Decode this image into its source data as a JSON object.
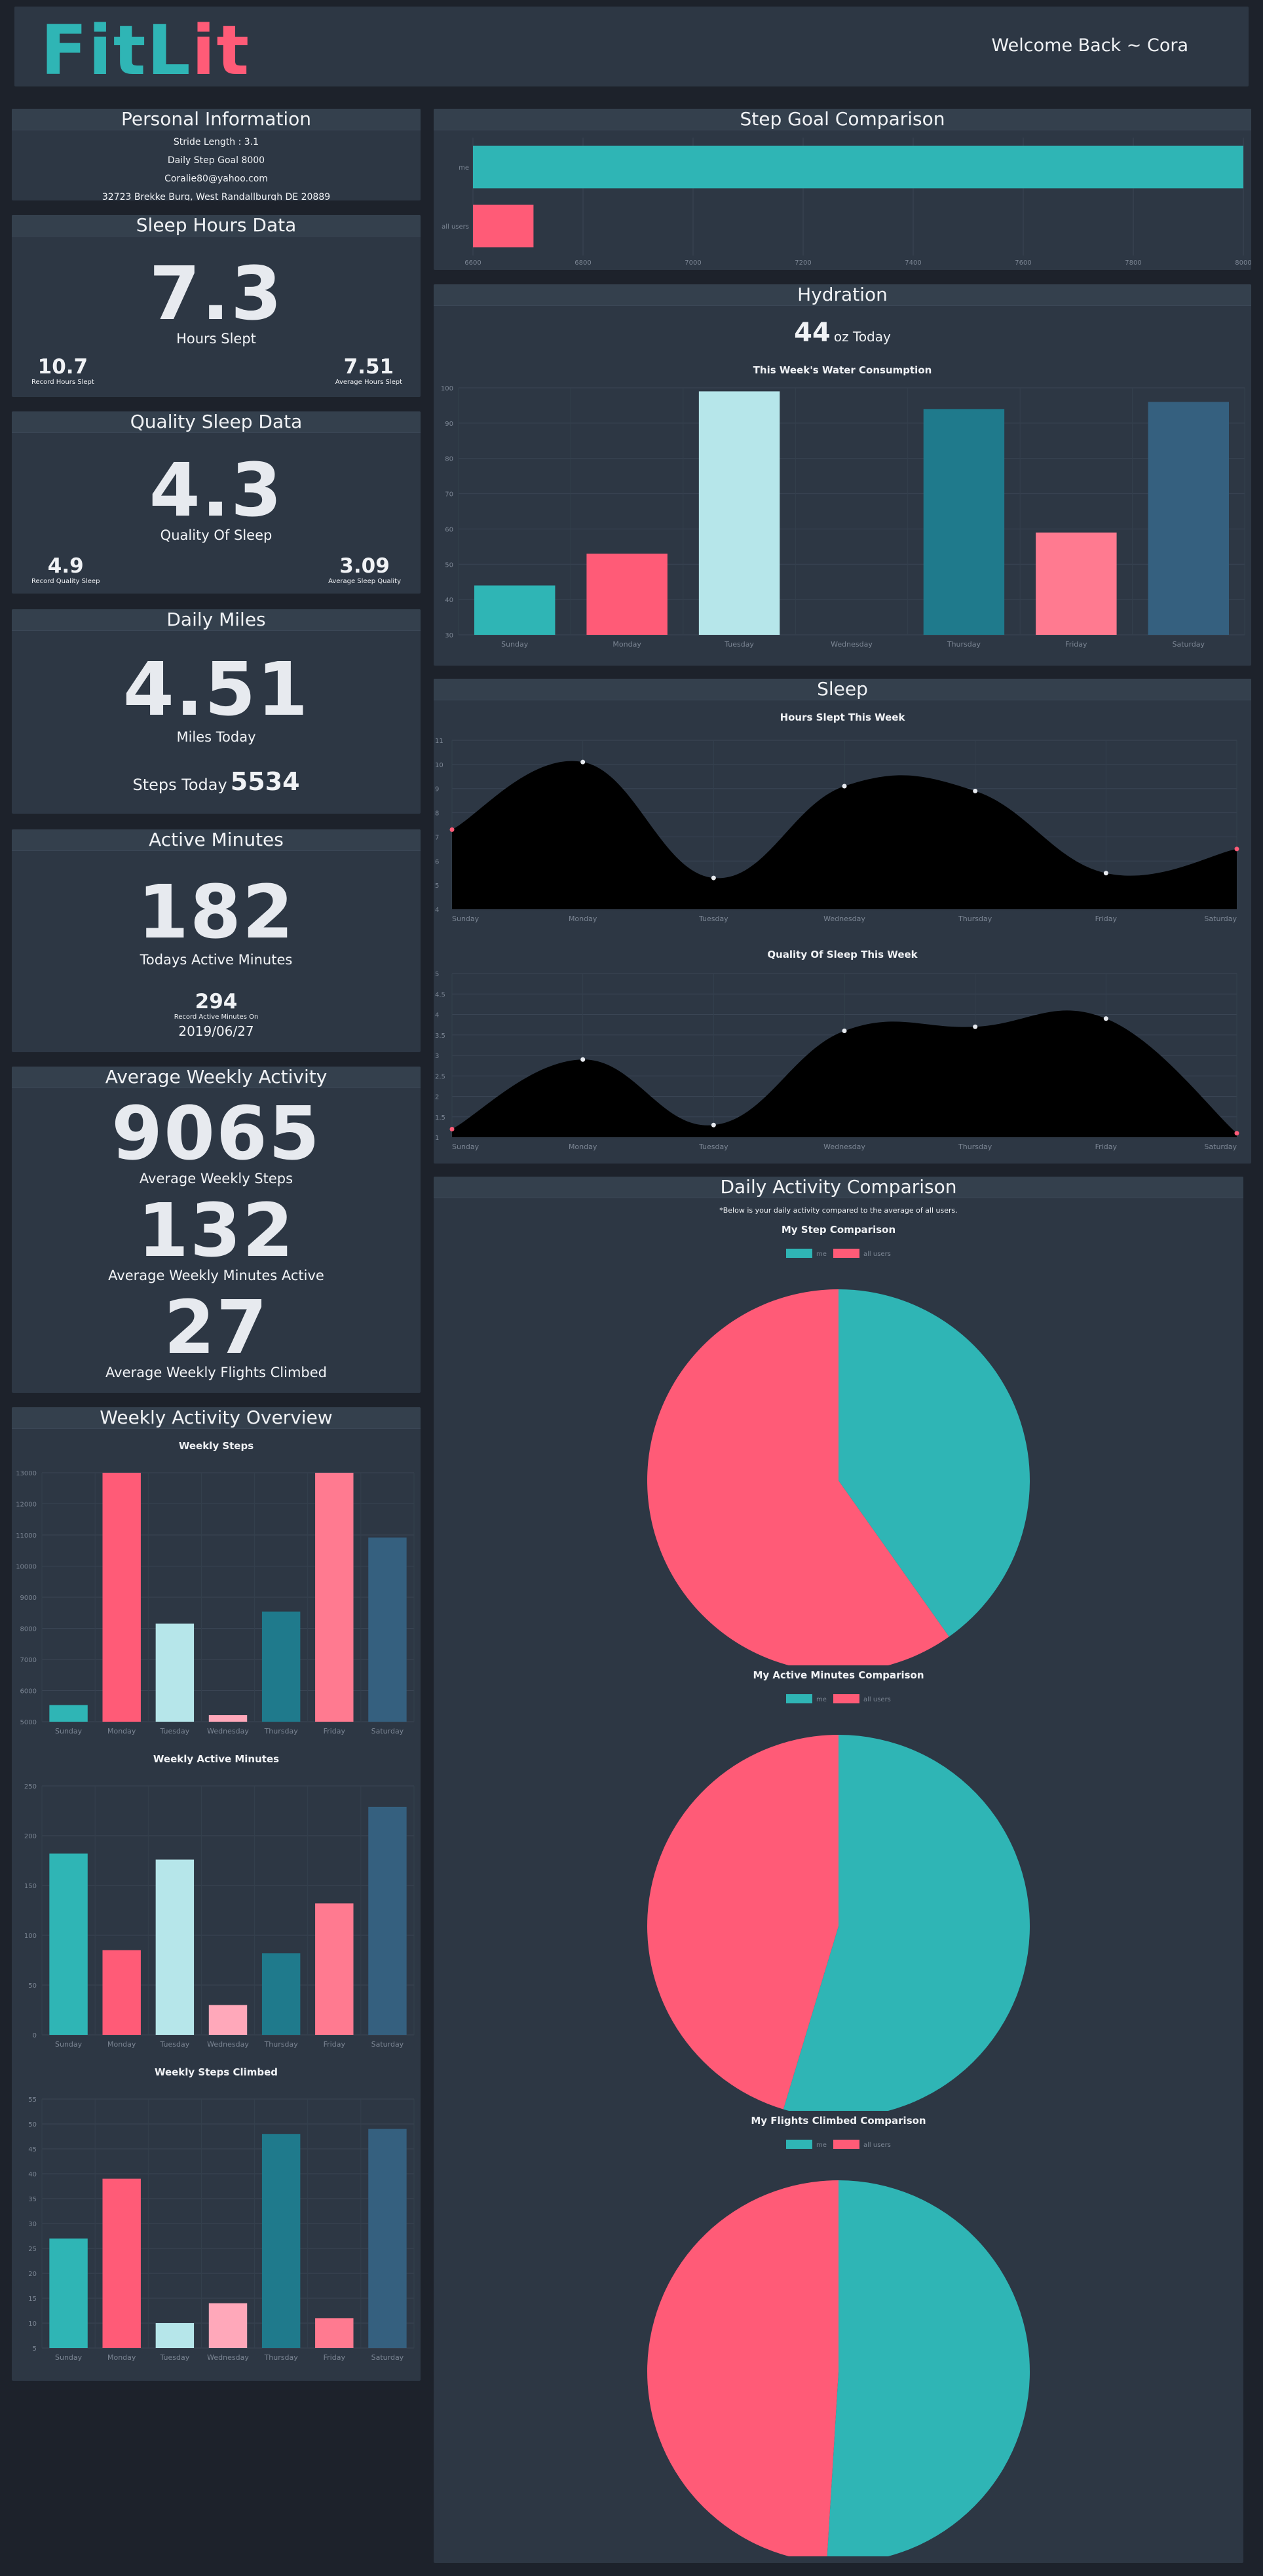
{
  "header": {
    "logo_part1": "Fit",
    "logo_part2_l": "L",
    "logo_part2_it": "it",
    "welcome": "Welcome Back ~ Cora"
  },
  "personal_info": {
    "title": "Personal Information",
    "stride": "Stride Length : 3.1",
    "goal": "Daily Step Goal 8000",
    "email": "Coralie80@yahoo.com",
    "address": "32723 Brekke Burg, West Randallburgh DE 20889"
  },
  "sleep_hours": {
    "title": "Sleep Hours Data",
    "value": "7.3",
    "label": "Hours Slept",
    "record_value": "10.7",
    "record_label": "Record Hours Slept",
    "avg_value": "7.51",
    "avg_label": "Average Hours Slept"
  },
  "quality_sleep": {
    "title": "Quality Sleep Data",
    "value": "4.3",
    "label": "Quality Of Sleep",
    "record_value": "4.9",
    "record_label": "Record Quality Sleep",
    "avg_value": "3.09",
    "avg_label": "Average Sleep Quality"
  },
  "daily_miles": {
    "title": "Daily Miles",
    "value": "4.51",
    "label": "Miles Today",
    "steps_label": "Steps Today",
    "steps_value": "5534"
  },
  "active_minutes": {
    "title": "Active Minutes",
    "value": "182",
    "label": "Todays Active Minutes",
    "record_value": "294",
    "record_label": "Record Active Minutes On",
    "record_date": "2019/06/27"
  },
  "avg_weekly": {
    "title": "Average Weekly Activity",
    "steps_value": "9065",
    "steps_label": "Average Weekly Steps",
    "minutes_value": "132",
    "minutes_label": "Average Weekly Minutes Active",
    "flights_value": "27",
    "flights_label": "Average Weekly Flights Climbed"
  },
  "weekly_overview": {
    "title": "Weekly Activity Overview"
  },
  "step_goal": {
    "title": "Step Goal Comparison"
  },
  "hydration": {
    "title": "Hydration",
    "oz_value": "44",
    "oz_label": "oz Today"
  },
  "sleep_section": {
    "title": "Sleep"
  },
  "daily_comparison": {
    "title": "Daily Activity Comparison",
    "note": "*Below is your daily activity compared to the average of all users."
  },
  "colors": {
    "teal": "#2fb5b5",
    "pink": "#ff5b77",
    "lightblue": "#b6e6ea",
    "lightpink": "#ffa8ba",
    "darkteal": "#1f7a8c",
    "slateblue": "#35607f",
    "rose": "#ff7a90"
  },
  "chart_data": [
    {
      "id": "step_goal",
      "type": "bar",
      "orientation": "horizontal",
      "categories": [
        "me",
        "all users"
      ],
      "values": [
        8000,
        6710
      ],
      "xlim": [
        6600,
        8000
      ],
      "xticks": [
        "6600",
        "6800",
        "7000",
        "7200",
        "7400",
        "7600",
        "7800",
        "8000"
      ]
    },
    {
      "id": "hydration",
      "type": "bar",
      "title": "This Week's Water Consumption",
      "categories": [
        "Sunday",
        "Monday",
        "Tuesday",
        "Wednesday",
        "Thursday",
        "Friday",
        "Saturday"
      ],
      "values": [
        44,
        53,
        99,
        30,
        94,
        59,
        96
      ],
      "ylim": [
        30,
        100
      ],
      "yticks": [
        "30",
        "40",
        "50",
        "60",
        "70",
        "80",
        "90",
        "100"
      ]
    },
    {
      "id": "hours_slept",
      "type": "area",
      "title": "Hours Slept This Week",
      "categories": [
        "Sunday",
        "Monday",
        "Tuesday",
        "Wednesday",
        "Thursday",
        "Friday",
        "Saturday"
      ],
      "values": [
        7.3,
        10.1,
        5.3,
        9.1,
        8.9,
        5.5,
        6.5
      ],
      "ylim": [
        4,
        11
      ],
      "yticks": [
        "4",
        "5",
        "6",
        "7",
        "8",
        "9",
        "10",
        "11"
      ]
    },
    {
      "id": "quality_sleep",
      "type": "area",
      "title": "Quality Of Sleep This Week",
      "categories": [
        "Sunday",
        "Monday",
        "Tuesday",
        "Wednesday",
        "Thursday",
        "Friday",
        "Saturday"
      ],
      "values": [
        1.2,
        2.9,
        1.3,
        3.6,
        3.7,
        3.9,
        1.1
      ],
      "ylim": [
        1,
        5
      ],
      "yticks": [
        "1",
        "1.5",
        "2",
        "2.5",
        "3",
        "3.5",
        "4",
        "4.5",
        "5"
      ]
    },
    {
      "id": "weekly_steps",
      "type": "bar",
      "title": "Weekly Steps",
      "categories": [
        "Sunday",
        "Monday",
        "Tuesday",
        "Wednesday",
        "Thursday",
        "Friday",
        "Saturday"
      ],
      "values": [
        5534,
        13580,
        8150,
        5210,
        8540,
        13520,
        10920
      ],
      "ylim": [
        5000,
        13000
      ],
      "yticks": [
        "5000",
        "6000",
        "7000",
        "8000",
        "9000",
        "10000",
        "11000",
        "12000",
        "13000"
      ]
    },
    {
      "id": "weekly_minutes",
      "type": "bar",
      "title": "Weekly Active Minutes",
      "categories": [
        "Sunday",
        "Monday",
        "Tuesday",
        "Wednesday",
        "Thursday",
        "Friday",
        "Saturday"
      ],
      "values": [
        182,
        85,
        176,
        30,
        82,
        132,
        229
      ],
      "ylim": [
        0,
        250
      ],
      "yticks": [
        "0",
        "50",
        "100",
        "150",
        "200",
        "250"
      ]
    },
    {
      "id": "weekly_flights",
      "type": "bar",
      "title": "Weekly Steps Climbed",
      "categories": [
        "Sunday",
        "Monday",
        "Tuesday",
        "Wednesday",
        "Thursday",
        "Friday",
        "Saturday"
      ],
      "values": [
        27,
        39,
        10,
        14,
        48,
        11,
        49
      ],
      "ylim": [
        5,
        55
      ],
      "yticks": [
        "5",
        "10",
        "15",
        "20",
        "25",
        "30",
        "35",
        "40",
        "45",
        "50",
        "55"
      ]
    },
    {
      "id": "pie_steps",
      "type": "pie",
      "title": "My Step Comparison",
      "labels": [
        "me",
        "all users"
      ],
      "values": [
        5534,
        8235
      ]
    },
    {
      "id": "pie_minutes",
      "type": "pie",
      "title": "My Active Minutes Comparison",
      "labels": [
        "me",
        "all users"
      ],
      "values": [
        182,
        151
      ]
    },
    {
      "id": "pie_flights",
      "type": "pie",
      "title": "My Flights Climbed Comparison",
      "labels": [
        "me",
        "all users"
      ],
      "values": [
        26,
        25
      ]
    }
  ]
}
